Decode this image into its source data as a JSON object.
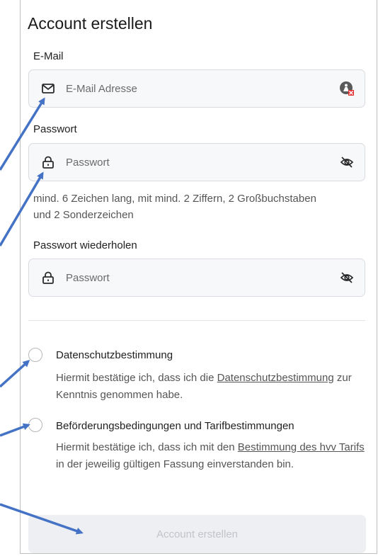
{
  "form": {
    "title": "Account erstellen",
    "email": {
      "label": "E-Mail",
      "placeholder": "E-Mail Adresse",
      "value": ""
    },
    "password": {
      "label": "Passwort",
      "placeholder": "Passwort",
      "value": "",
      "hint_line1": "mind. 6 Zeichen lang, mit mind. 2 Ziffern, 2 Großbuchstaben",
      "hint_line2": "und 2 Sonderzeichen"
    },
    "password_repeat": {
      "label": "Passwort wiederholen",
      "placeholder": "Passwort",
      "value": ""
    },
    "privacy": {
      "title": "Datenschutzbestimmung",
      "text_before": "Hiermit bestätige ich, dass ich die ",
      "link": "Datenschutzbestimmung",
      "text_after": " zur Kenntnis genommen habe.",
      "checked": false
    },
    "terms": {
      "title": "Beförderungsbedingungen und Tarifbestimmungen",
      "text_before": "Hiermit bestätige ich, dass ich mit den ",
      "link": "Bestimmung des hvv Tarifs",
      "text_after": " in der jeweilig gültigen Fassung einverstanden bin.",
      "checked": false
    },
    "submit_label": "Account erstellen",
    "submit_enabled": false
  },
  "colors": {
    "arrow": "#4472c4",
    "submit_bg": "#eeeff2",
    "submit_text": "#c2c4c9",
    "field_bg": "#f7f8fa"
  },
  "icons": {
    "email_field": "envelope-icon",
    "email_extension": "password-manager-icon",
    "password_fields": "lock-icon",
    "password_toggle": "eye-off-icon"
  }
}
